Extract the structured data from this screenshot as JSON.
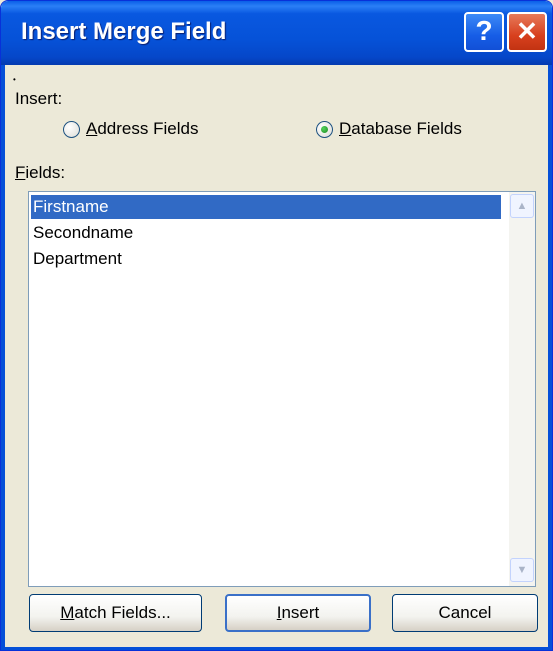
{
  "window": {
    "title": "Insert Merge Field",
    "help_glyph": "?",
    "close_glyph": "✕"
  },
  "insert": {
    "label": "Insert:",
    "address_fields": {
      "access_key": "A",
      "rest": "ddress Fields",
      "checked": false
    },
    "database_fields": {
      "access_key": "D",
      "rest": "atabase Fields",
      "checked": true
    }
  },
  "fields": {
    "label_key": "F",
    "label_rest": "ields:",
    "items": [
      "Firstname",
      "Secondname",
      "Department"
    ],
    "selected_index": 0
  },
  "scrollbar": {
    "up_icon": "chevron-up-icon",
    "down_icon": "chevron-down-icon"
  },
  "buttons": {
    "match_fields": {
      "key": "M",
      "rest": "atch Fields..."
    },
    "insert": {
      "key": "I",
      "rest": "nsert"
    },
    "cancel": {
      "label": "Cancel"
    }
  },
  "colors": {
    "title_bar": "#0652d8",
    "selection": "#316ac5",
    "dialog_bg": "#ece9d8"
  }
}
